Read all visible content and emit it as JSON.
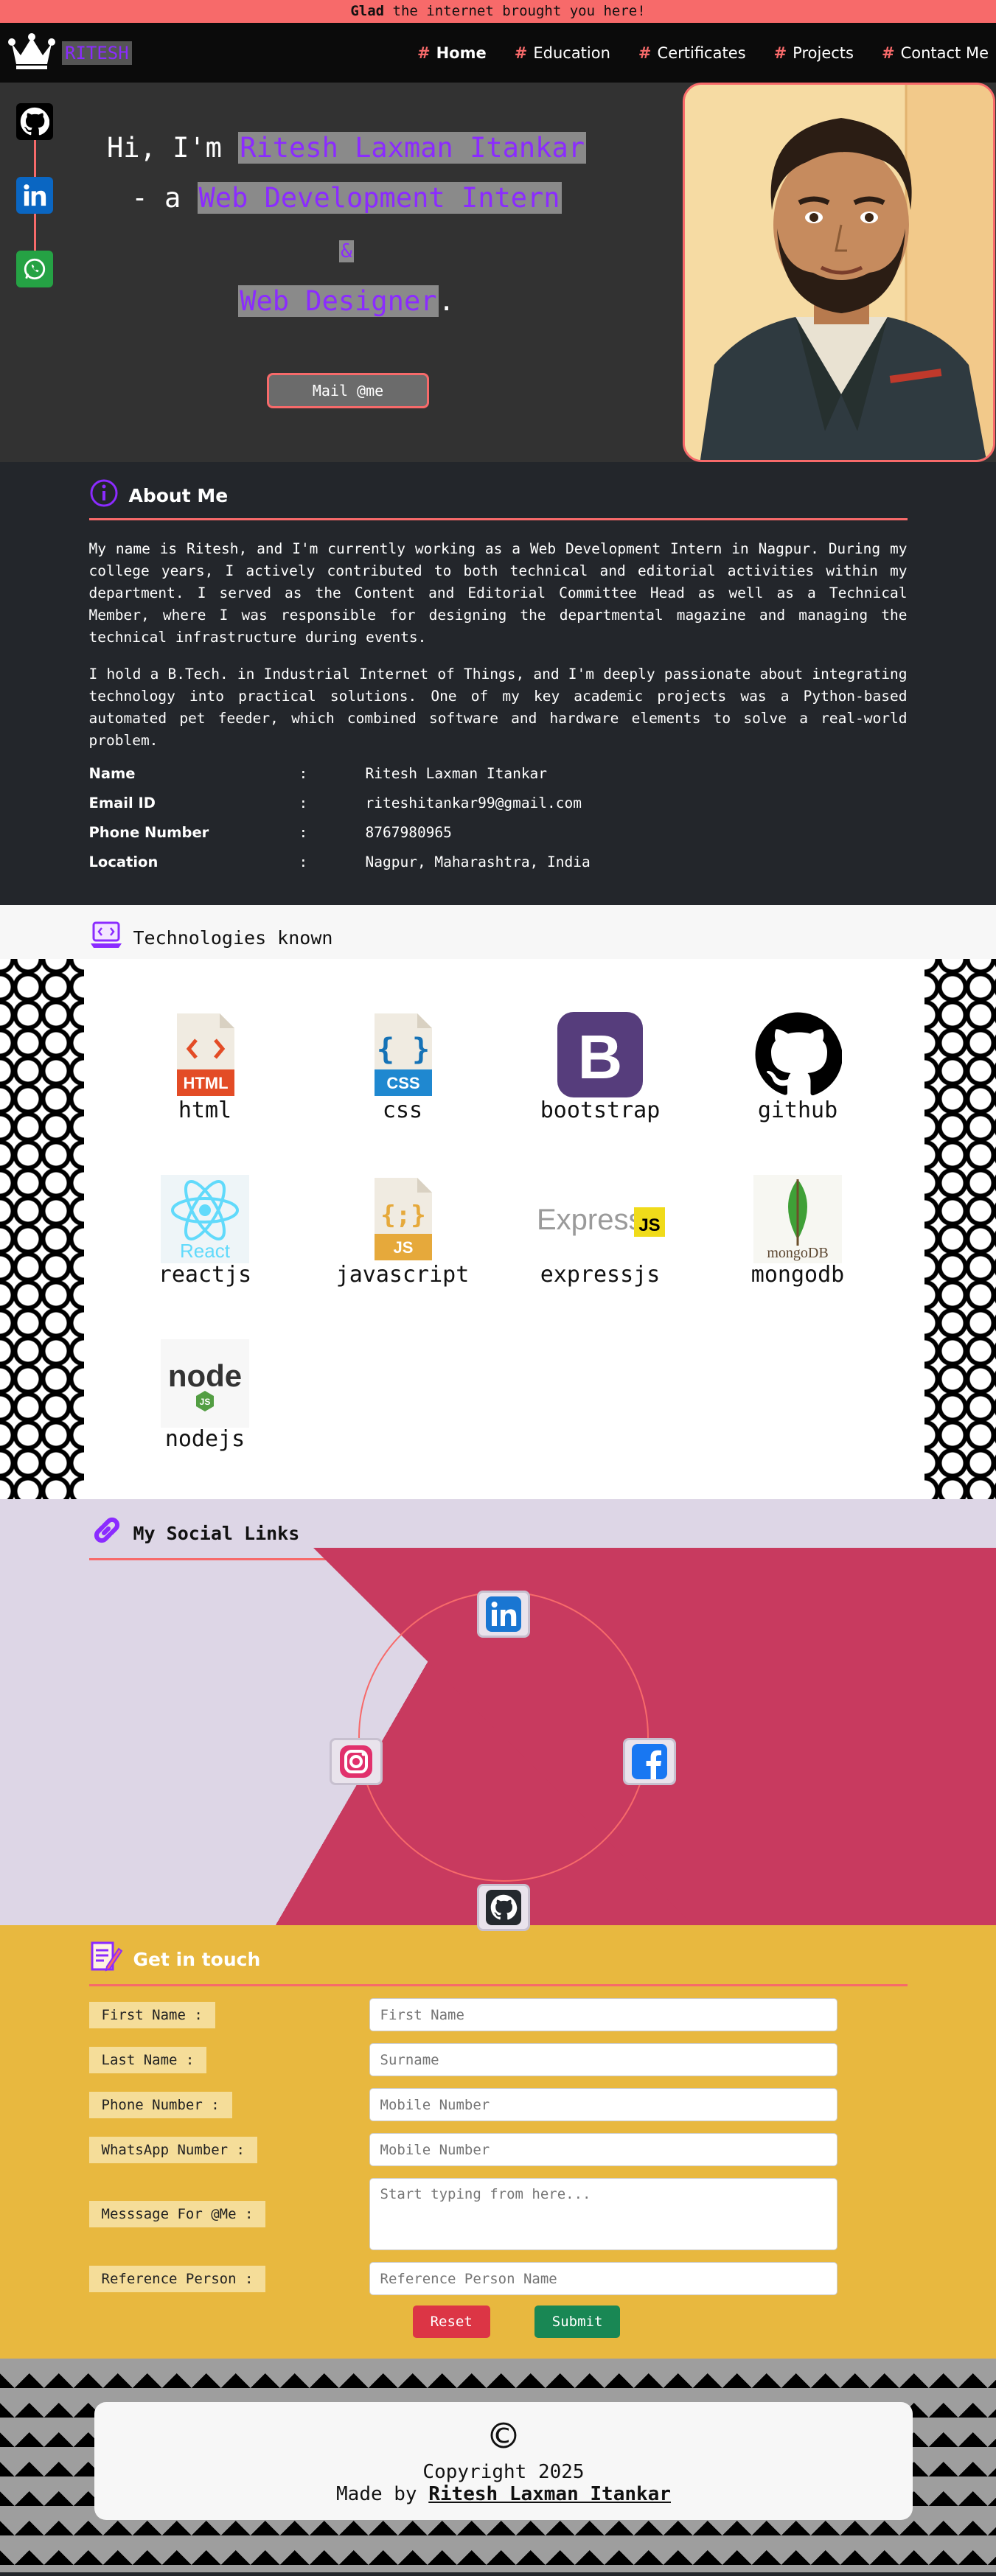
{
  "banner": {
    "bold": "Glad",
    "rest": " the internet brought you here!"
  },
  "nav": {
    "brand": "RITESH",
    "brand_icon": "crown-icon",
    "links": [
      {
        "label": "Home"
      },
      {
        "label": "Education"
      },
      {
        "label": "Certificates"
      },
      {
        "label": "Projects"
      },
      {
        "label": "Contact Me"
      }
    ],
    "hash": "#"
  },
  "hero": {
    "line1_prefix": "Hi, I'm ",
    "name": "Ritesh Laxman Itankar",
    "line2_prefix": "- a ",
    "role1": "Web Development Intern",
    "amp": "&",
    "role2": "Web Designer",
    "period": ".",
    "mail_button": "Mail @me",
    "rail_icons": [
      "github-icon",
      "linkedin-icon",
      "whatsapp-icon"
    ]
  },
  "about": {
    "title": "About Me",
    "p1": "My name is Ritesh, and I'm currently working as a Web Development Intern in Nagpur. During my college years, I actively contributed to both technical and editorial activities within my department. I served as the Content and Editorial Committee Head as well as a Technical Member, where I was responsible for designing the departmental magazine and managing the technical infrastructure during events.",
    "p2": "I hold a B.Tech. in Industrial Internet of Things, and I'm deeply passionate about integrating technology into practical solutions. One of my key academic projects was a Python-based automated pet feeder, which combined software and hardware elements to solve a real-world problem.",
    "info": [
      {
        "key": "Name",
        "sep": ":",
        "value": "Ritesh Laxman Itankar"
      },
      {
        "key": "Email ID",
        "sep": ":",
        "value": "riteshitankar99@gmail.com"
      },
      {
        "key": "Phone Number",
        "sep": ":",
        "value": "8767980965"
      },
      {
        "key": "Location",
        "sep": ":",
        "value": "Nagpur, Maharashtra, India"
      }
    ]
  },
  "tech": {
    "title": "Technologies known",
    "items": [
      {
        "label": "html",
        "icon": "html-icon",
        "badge": "HTML"
      },
      {
        "label": "css",
        "icon": "css-icon",
        "badge": "CSS"
      },
      {
        "label": "bootstrap",
        "icon": "bootstrap-icon",
        "badge": "B"
      },
      {
        "label": "github",
        "icon": "github-icon"
      },
      {
        "label": "reactjs",
        "icon": "react-icon",
        "badge": "React"
      },
      {
        "label": "javascript",
        "icon": "javascript-icon",
        "badge": "JS"
      },
      {
        "label": "expressjs",
        "icon": "express-icon",
        "badge": "Express",
        "badge2": "JS"
      },
      {
        "label": "mongodb",
        "icon": "mongodb-icon",
        "badge": "mongoDB"
      },
      {
        "label": "nodejs",
        "icon": "nodejs-icon",
        "badge": "node",
        "badge2": "JS"
      }
    ]
  },
  "social": {
    "title": "My Social Links",
    "links": [
      "linkedin-icon",
      "instagram-icon",
      "facebook-icon",
      "github-icon"
    ],
    "colors": {
      "left": "#ddd6e6",
      "right": "#c83a5f",
      "circle": "#f76a6a"
    }
  },
  "contact": {
    "title": "Get in touch",
    "fields": [
      {
        "label": "First Name :",
        "placeholder": "First Name"
      },
      {
        "label": "Last Name :",
        "placeholder": "Surname"
      },
      {
        "label": "Phone Number :",
        "placeholder": "Mobile Number"
      },
      {
        "label": "WhatsApp Number :",
        "placeholder": "Mobile Number"
      },
      {
        "label": "Messsage For @Me :",
        "placeholder": "Start typing from here..."
      },
      {
        "label": "Reference Person :",
        "placeholder": "Reference Person Name"
      }
    ],
    "reset": "Reset",
    "submit": "Submit"
  },
  "footer": {
    "symbol": "©",
    "copyright": "Copyright 2025",
    "made_by_prefix": "Made by ",
    "made_by_name": "Ritesh Laxman Itankar"
  },
  "colors": {
    "accent": "#f76a6a",
    "purple": "#8b2bff",
    "dark": "#23262b",
    "gold": "#e8b83f"
  }
}
